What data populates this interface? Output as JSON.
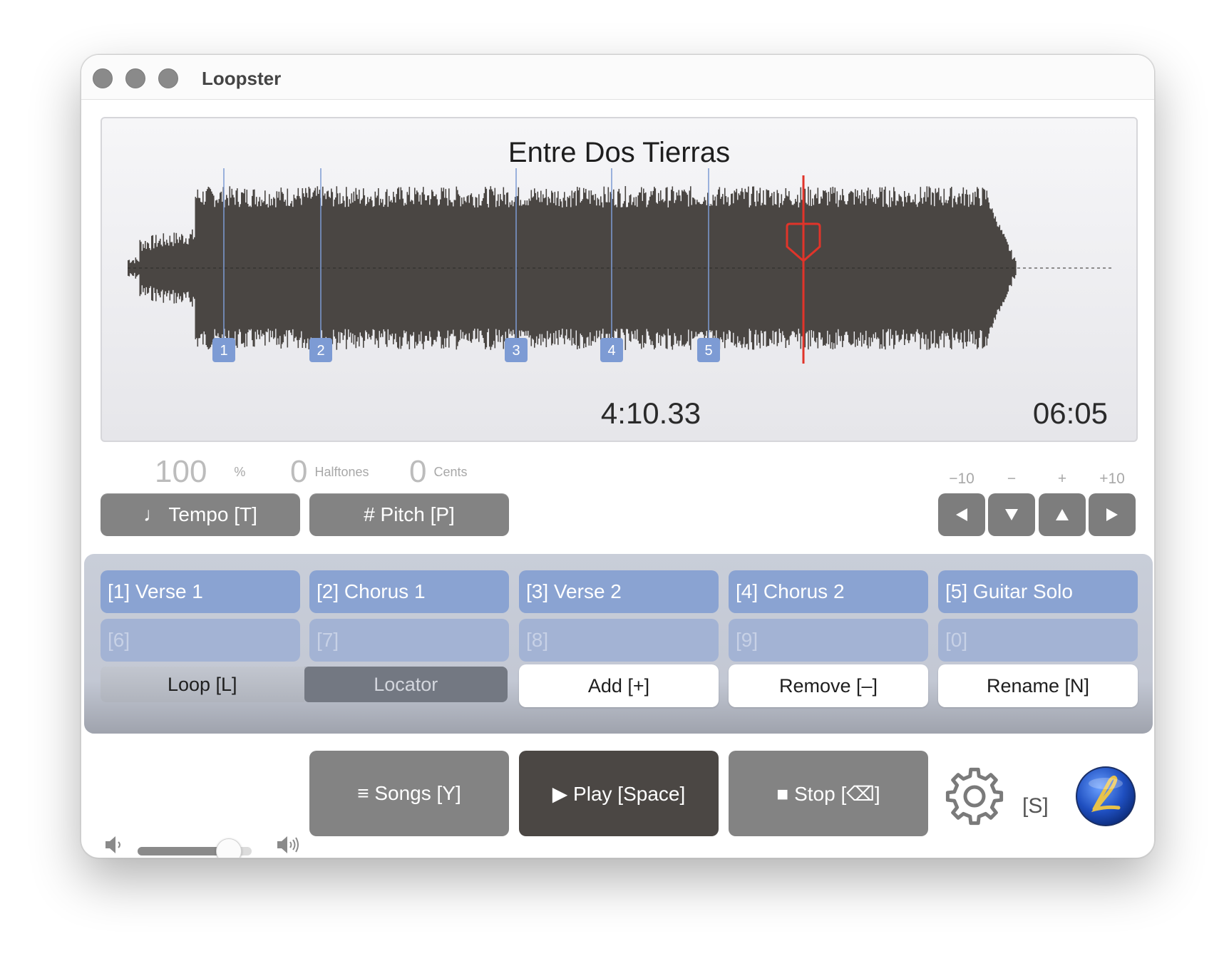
{
  "window": {
    "title": "Loopster"
  },
  "waveform": {
    "song_title": "Entre Dos Tierras",
    "current_time": "4:10.33",
    "total_time": "06:05",
    "markers": [
      "1",
      "2",
      "3",
      "4",
      "5"
    ]
  },
  "controls": {
    "tempo_value": "100",
    "tempo_unit": "%",
    "halftones_value": "0",
    "halftones_unit": "Halftones",
    "cents_value": "0",
    "cents_unit": "Cents",
    "tempo_label": "♩ Tempo [T]",
    "pitch_label": "# Pitch [P]",
    "nudge_labels": [
      "−10",
      "−",
      "+",
      "+10"
    ]
  },
  "locators": {
    "items": [
      {
        "label": "[1] Verse 1"
      },
      {
        "label": "[2] Chorus 1"
      },
      {
        "label": "[3] Verse 2"
      },
      {
        "label": "[4] Chorus 2"
      },
      {
        "label": "[5] Guitar Solo"
      },
      {
        "label": "[6]"
      },
      {
        "label": "[7]"
      },
      {
        "label": "[8]"
      },
      {
        "label": "[9]"
      },
      {
        "label": "[0]"
      }
    ],
    "mode_loop": "Loop [L]",
    "mode_locator": "Locator",
    "add_label": "Add [+]",
    "remove_label": "Remove [–]",
    "rename_label": "Rename [N]"
  },
  "transport": {
    "volume": 0.8,
    "songs_label": "≡ Songs [Y]",
    "play_label": "▶ Play [Space]",
    "stop_label": "■ Stop [⌫]",
    "settings_shortcut": "[S]"
  },
  "colors": {
    "waveform": "#4a4643",
    "playhead": "#e0342a",
    "marker": "#7d9bd4",
    "locator_filled": "#8aa3d2",
    "play_button": "#4b4744",
    "gray_button": "#838383"
  }
}
